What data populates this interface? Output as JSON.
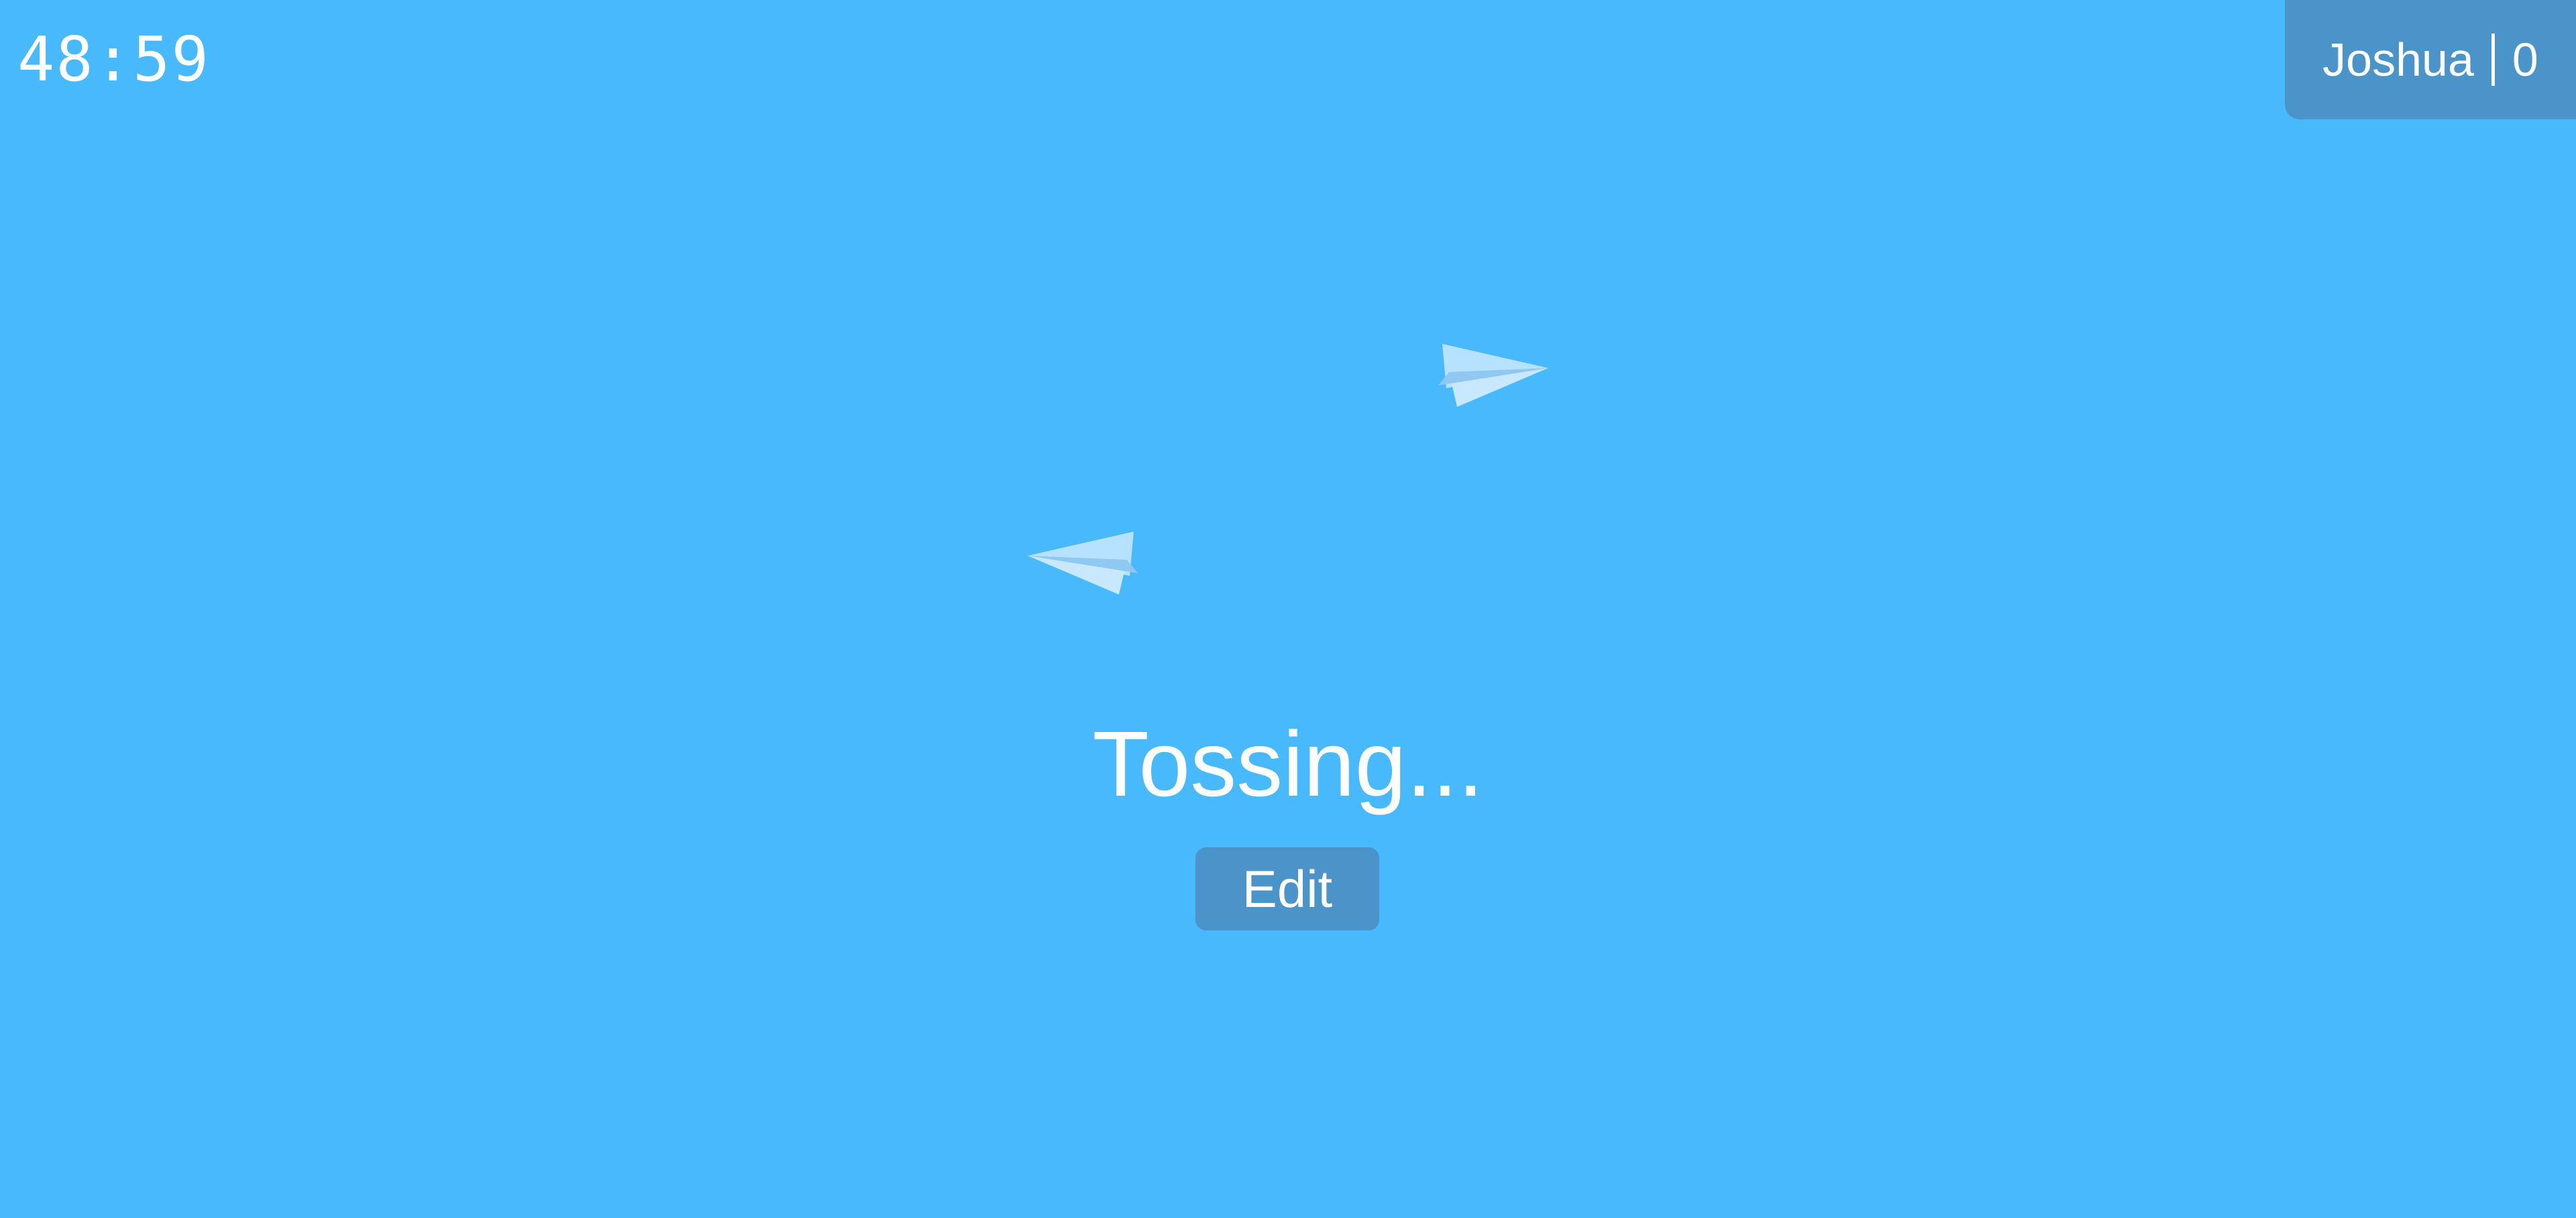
{
  "timer": {
    "value": "48:59"
  },
  "player": {
    "name": "Joshua",
    "score": "0"
  },
  "status": {
    "text": "Tossing..."
  },
  "actions": {
    "edit_label": "Edit"
  },
  "decor": {
    "icons": [
      "paper-plane-icon",
      "paper-plane-icon"
    ]
  },
  "colors": {
    "background": "#49b9fd",
    "panel": "#4b94c9",
    "text": "#ffffff",
    "plane_light": "#b7e2ff",
    "plane_shadow": "#8fc8f1"
  }
}
